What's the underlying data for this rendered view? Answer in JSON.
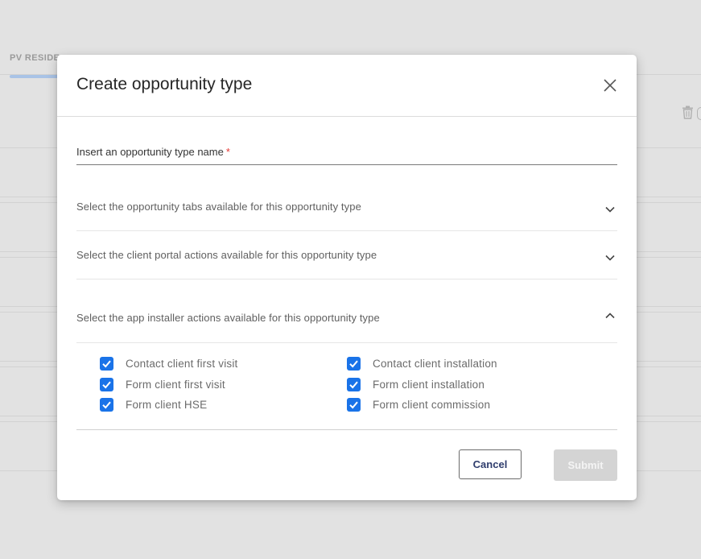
{
  "background": {
    "tab_label": "PV RESIDE"
  },
  "modal": {
    "title": "Create opportunity type",
    "name_field": {
      "label": "Insert an opportunity type name",
      "required_marker": "*",
      "value": ""
    },
    "sections": [
      {
        "label": "Select the opportunity tabs available for this opportunity type",
        "expanded": false
      },
      {
        "label": "Select the client portal actions available for this opportunity type",
        "expanded": false
      },
      {
        "label": "Select the app installer actions available for this opportunity type",
        "expanded": true
      }
    ],
    "installer_actions": [
      {
        "label": "Contact client first visit",
        "checked": true
      },
      {
        "label": "Form client first visit",
        "checked": true
      },
      {
        "label": "Form client HSE",
        "checked": true
      },
      {
        "label": "Contact client installation",
        "checked": true
      },
      {
        "label": "Form client installation",
        "checked": true
      },
      {
        "label": "Form client commission",
        "checked": true
      }
    ],
    "buttons": {
      "cancel": "Cancel",
      "submit": "Submit"
    }
  },
  "colors": {
    "checkbox_accent": "#1a73e8",
    "required": "#e53935",
    "submit_disabled_bg": "#d4d4d4",
    "cancel_text": "#2f3d6d"
  },
  "icons": {
    "close": "close-icon",
    "collapsed": "chevron-down-icon",
    "expanded": "chevron-up-icon",
    "checkbox": "checkmark-icon",
    "delete": "trash-icon"
  }
}
